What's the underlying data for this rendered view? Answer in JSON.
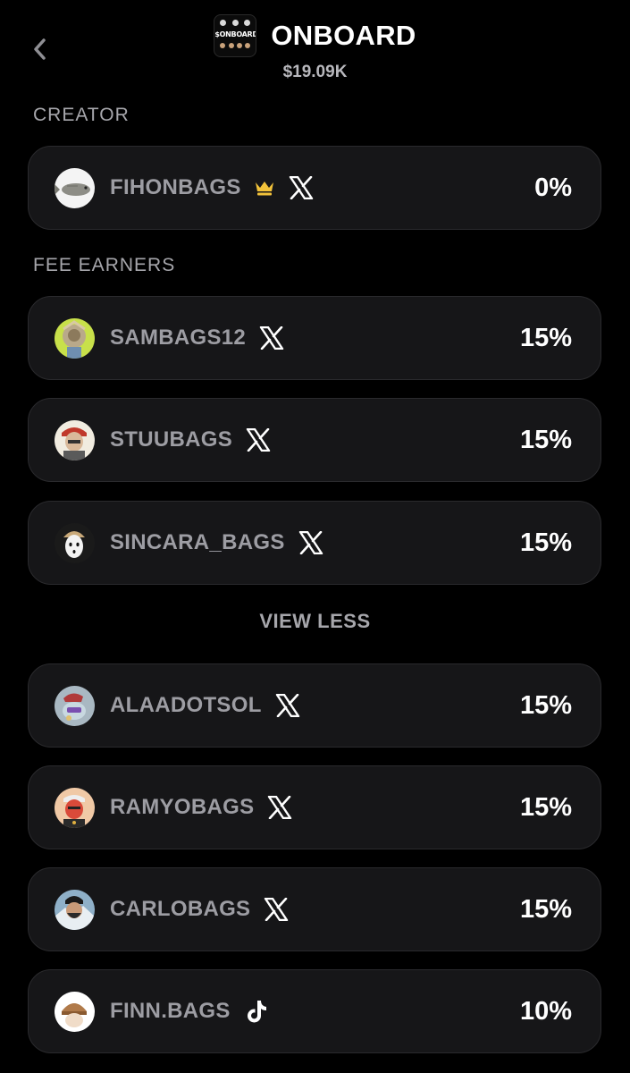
{
  "header": {
    "token_name": "ONBOARD",
    "token_value": "$19.09K",
    "logo_text": "$ONBOARD"
  },
  "sections": {
    "creator_label": "CREATOR",
    "fee_earners_label": "FEE EARNERS"
  },
  "creator": {
    "name": "FIHONBAGS",
    "badge": "crown-icon",
    "social": "x-icon",
    "percent": "0%"
  },
  "fee_earners": [
    {
      "name": "SAMBAGS12",
      "social": "x-icon",
      "percent": "15%"
    },
    {
      "name": "STUUBAGS",
      "social": "x-icon",
      "percent": "15%"
    },
    {
      "name": "SINCARA_BAGS",
      "social": "x-icon",
      "percent": "15%"
    },
    {
      "name": "ALAADOTSOL",
      "social": "x-icon",
      "percent": "15%"
    },
    {
      "name": "RAMYOBAGS",
      "social": "x-icon",
      "percent": "15%"
    },
    {
      "name": "CARLOBAGS",
      "social": "x-icon",
      "percent": "15%"
    },
    {
      "name": "FINN.BAGS",
      "social": "tiktok-icon",
      "percent": "10%"
    }
  ],
  "view_less_label": "VIEW LESS",
  "colors": {
    "background": "#000000",
    "card": "#161618",
    "card_border": "#2a2a2d",
    "muted_text": "#9d9da3",
    "crown": "#f2c23a"
  }
}
